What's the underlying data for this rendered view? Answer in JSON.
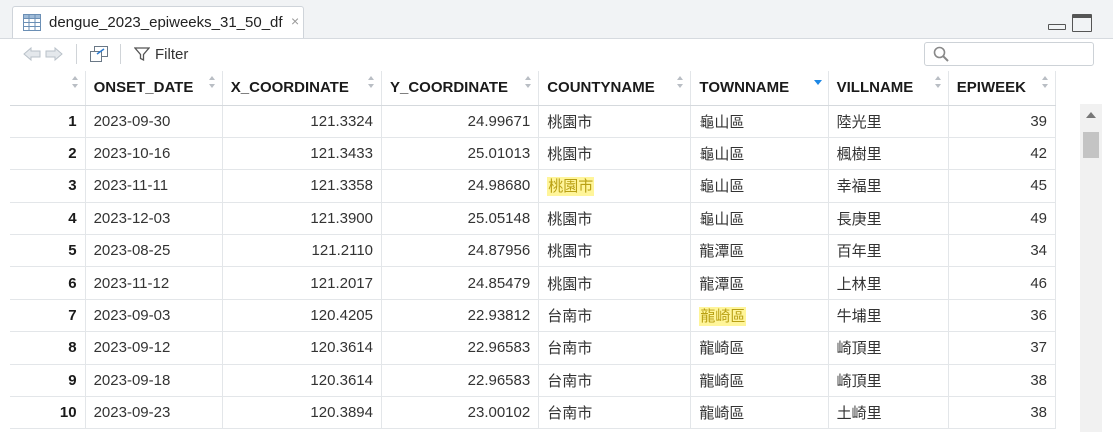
{
  "tab": {
    "title": "dengue_2023_epiweeks_31_50_df",
    "close_glyph": "×"
  },
  "toolbar": {
    "filter_label": "Filter",
    "search_value": ""
  },
  "columns": [
    "ONSET_DATE",
    "X_COORDINATE",
    "Y_COORDINATE",
    "COUNTYNAME",
    "TOWNNAME",
    "VILLNAME",
    "EPIWEEK"
  ],
  "sorted_column": "TOWNNAME",
  "highlight_color": "#fff59a",
  "rows": [
    {
      "id": "1",
      "onset_date": "2023-09-30",
      "x": "121.3324",
      "y": "24.99671",
      "county": "桃園市",
      "town": "龜山區",
      "vill": "陸光里",
      "epiweek": "39"
    },
    {
      "id": "2",
      "onset_date": "2023-10-16",
      "x": "121.3433",
      "y": "25.01013",
      "county": "桃園市",
      "town": "龜山區",
      "vill": "楓樹里",
      "epiweek": "42"
    },
    {
      "id": "3",
      "onset_date": "2023-11-11",
      "x": "121.3358",
      "y": "24.98680",
      "county": "桃園市",
      "town": "龜山區",
      "vill": "幸福里",
      "epiweek": "45"
    },
    {
      "id": "4",
      "onset_date": "2023-12-03",
      "x": "121.3900",
      "y": "25.05148",
      "county": "桃園市",
      "town": "龜山區",
      "vill": "長庚里",
      "epiweek": "49"
    },
    {
      "id": "5",
      "onset_date": "2023-08-25",
      "x": "121.2110",
      "y": "24.87956",
      "county": "桃園市",
      "town": "龍潭區",
      "vill": "百年里",
      "epiweek": "34"
    },
    {
      "id": "6",
      "onset_date": "2023-11-12",
      "x": "121.2017",
      "y": "24.85479",
      "county": "桃園市",
      "town": "龍潭區",
      "vill": "上林里",
      "epiweek": "46"
    },
    {
      "id": "7",
      "onset_date": "2023-09-03",
      "x": "120.4205",
      "y": "22.93812",
      "county": "台南市",
      "town": "龍崎區",
      "vill": "牛埔里",
      "epiweek": "36"
    },
    {
      "id": "8",
      "onset_date": "2023-09-12",
      "x": "120.3614",
      "y": "22.96583",
      "county": "台南市",
      "town": "龍崎區",
      "vill": "崎頂里",
      "epiweek": "37"
    },
    {
      "id": "9",
      "onset_date": "2023-09-18",
      "x": "120.3614",
      "y": "22.96583",
      "county": "台南市",
      "town": "龍崎區",
      "vill": "崎頂里",
      "epiweek": "38"
    },
    {
      "id": "10",
      "onset_date": "2023-09-23",
      "x": "120.3894",
      "y": "23.00102",
      "county": "台南市",
      "town": "龍崎區",
      "vill": "土崎里",
      "epiweek": "38"
    }
  ]
}
